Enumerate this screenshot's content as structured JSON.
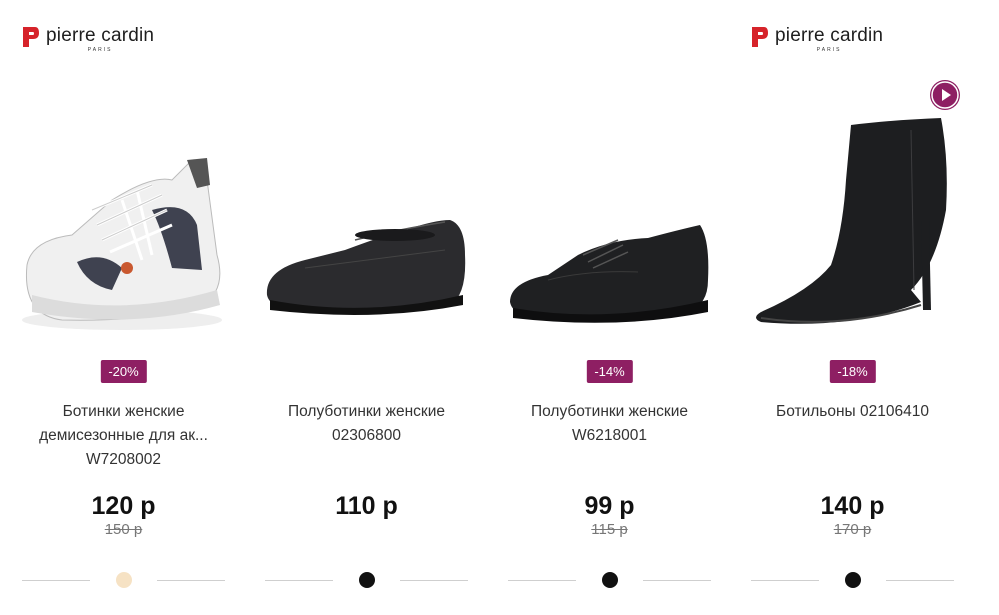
{
  "brand": {
    "name": "pierre cardin",
    "sub": "PARIS"
  },
  "accent": "#8e1f63",
  "products": [
    {
      "badge": "-20%",
      "title": [
        "Ботинки женские",
        "демисезонные для ак...",
        "W7208002"
      ],
      "price": "120 р",
      "old_price": "150 р",
      "dot_color": "#f6e2c4",
      "image": "sneaker-image"
    },
    {
      "badge": "",
      "title": [
        "Полуботинки женские",
        "02306800"
      ],
      "price": "110 р",
      "old_price": "",
      "dot_color": "#111111",
      "image": "slip-on-shoe-image"
    },
    {
      "badge": "-14%",
      "title": [
        "Полуботинки женские",
        "W6218001"
      ],
      "price": "99 р",
      "old_price": "115 р",
      "dot_color": "#111111",
      "image": "derby-shoe-image"
    },
    {
      "badge": "-18%",
      "title": [
        "Ботильоны 02106410"
      ],
      "price": "140 р",
      "old_price": "170 р",
      "dot_color": "#111111",
      "image": "ankle-boot-image"
    }
  ]
}
